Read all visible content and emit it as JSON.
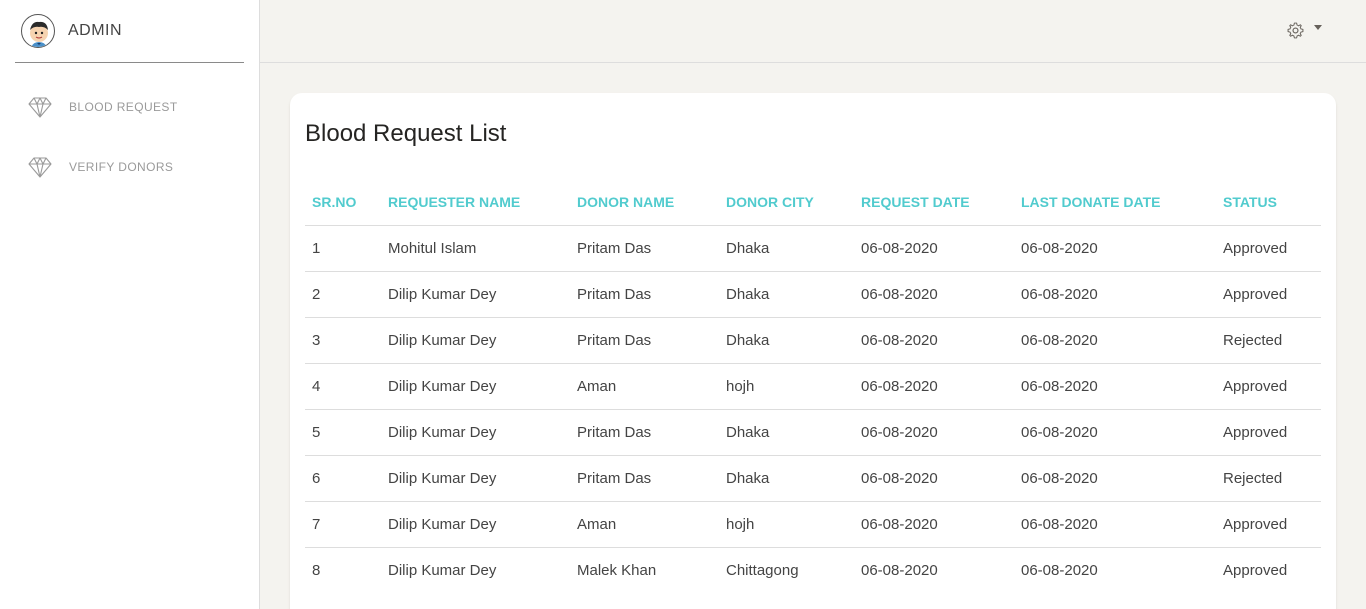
{
  "sidebar": {
    "brand": "ADMIN",
    "items": [
      {
        "label": "BLOOD REQUEST",
        "icon": "diamond-icon"
      },
      {
        "label": "VERIFY DONORS",
        "icon": "diamond-icon"
      }
    ]
  },
  "topbar": {
    "settings_icon": "gear-icon"
  },
  "main": {
    "title": "Blood Request List",
    "table": {
      "headers": [
        "SR.NO",
        "REQUESTER NAME",
        "DONOR NAME",
        "DONOR CITY",
        "REQUEST DATE",
        "LAST DONATE DATE",
        "STATUS"
      ],
      "rows": [
        [
          "1",
          "Mohitul Islam",
          "Pritam Das",
          "Dhaka",
          "06-08-2020",
          "06-08-2020",
          "Approved"
        ],
        [
          "2",
          "Dilip Kumar Dey",
          "Pritam Das",
          "Dhaka",
          "06-08-2020",
          "06-08-2020",
          "Approved"
        ],
        [
          "3",
          "Dilip Kumar Dey",
          "Pritam Das",
          "Dhaka",
          "06-08-2020",
          "06-08-2020",
          "Rejected"
        ],
        [
          "4",
          "Dilip Kumar Dey",
          "Aman",
          "hojh",
          "06-08-2020",
          "06-08-2020",
          "Approved"
        ],
        [
          "5",
          "Dilip Kumar Dey",
          "Pritam Das",
          "Dhaka",
          "06-08-2020",
          "06-08-2020",
          "Approved"
        ],
        [
          "6",
          "Dilip Kumar Dey",
          "Pritam Das",
          "Dhaka",
          "06-08-2020",
          "06-08-2020",
          "Rejected"
        ],
        [
          "7",
          "Dilip Kumar Dey",
          "Aman",
          "hojh",
          "06-08-2020",
          "06-08-2020",
          "Approved"
        ],
        [
          "8",
          "Dilip Kumar Dey",
          "Malek Khan",
          "Chittagong",
          "06-08-2020",
          "06-08-2020",
          "Approved"
        ]
      ]
    }
  },
  "colors": {
    "accent": "#51cbce",
    "background": "#f4f3ef"
  }
}
